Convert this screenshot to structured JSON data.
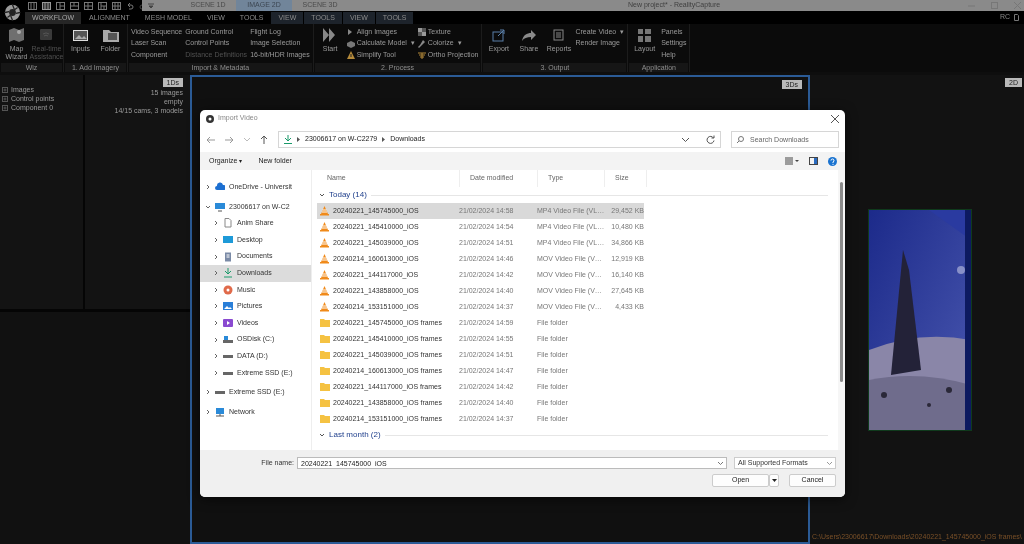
{
  "window": {
    "title": "New project* - RealityCapture",
    "account": "RC"
  },
  "scene_tabs": [
    {
      "label": "SCENE 1D",
      "selected": false
    },
    {
      "label": "IMAGE 2D",
      "selected": true
    },
    {
      "label": "SCENE 3D",
      "selected": false
    }
  ],
  "menu": [
    {
      "label": "WORKFLOW",
      "kind": "main",
      "selected": true
    },
    {
      "label": "ALIGNMENT",
      "kind": "main",
      "selected": false
    },
    {
      "label": "MESH MODEL",
      "kind": "main",
      "selected": false
    },
    {
      "label": "VIEW",
      "kind": "main",
      "selected": false
    },
    {
      "label": "TOOLS",
      "kind": "main",
      "selected": false
    },
    {
      "label": "VIEW",
      "kind": "context",
      "selected": false
    },
    {
      "label": "TOOLS",
      "kind": "context",
      "selected": false
    },
    {
      "label": "VIEW",
      "kind": "context",
      "selected": false
    },
    {
      "label": "TOOLS",
      "kind": "context",
      "selected": false
    }
  ],
  "ribbon": [
    {
      "label": "Wiz",
      "items": [
        {
          "kind": "large",
          "label": "Map Wizard",
          "disabled": false
        },
        {
          "kind": "large",
          "label": "Real-time Assistance",
          "disabled": true
        }
      ]
    },
    {
      "label": "1. Add Imagery",
      "items": [
        {
          "kind": "large",
          "label": "Inputs",
          "disabled": false
        },
        {
          "kind": "large",
          "label": "Folder",
          "disabled": false
        }
      ]
    },
    {
      "label": "Import & Metadata",
      "items": [
        {
          "kind": "list",
          "entries": [
            {
              "label": "Video Sequence",
              "disabled": false
            },
            {
              "label": "Laser Scan",
              "disabled": false
            },
            {
              "label": "Component",
              "disabled": false
            }
          ]
        },
        {
          "kind": "list",
          "entries": [
            {
              "label": "Ground Control",
              "disabled": false
            },
            {
              "label": "Control Points",
              "disabled": false
            },
            {
              "label": "Distance Definitions",
              "disabled": true
            }
          ]
        },
        {
          "kind": "list",
          "entries": [
            {
              "label": "Flight Log",
              "disabled": false
            },
            {
              "label": "Image Selection",
              "disabled": false
            },
            {
              "label": "16-bit/HDR Images",
              "disabled": false
            }
          ]
        }
      ]
    },
    {
      "label": "2. Process",
      "items": [
        {
          "kind": "large",
          "label": "Start",
          "disabled": false
        },
        {
          "kind": "icon-list",
          "entries": [
            {
              "label": "Align Images",
              "disabled": false
            },
            {
              "label": "Calculate Model",
              "caret": "▾",
              "disabled": false
            },
            {
              "label": "Simplify Tool",
              "disabled": false
            }
          ]
        },
        {
          "kind": "icon-list",
          "entries": [
            {
              "label": "Texture",
              "disabled": false
            },
            {
              "label": "Colorize",
              "caret": "▾",
              "disabled": false
            },
            {
              "label": "Ortho Projection",
              "disabled": false
            }
          ]
        }
      ]
    },
    {
      "label": "3. Output",
      "items": [
        {
          "kind": "large",
          "label": "Export",
          "disabled": false
        },
        {
          "kind": "large",
          "label": "Share",
          "disabled": false
        },
        {
          "kind": "large",
          "label": "Reports",
          "disabled": false
        },
        {
          "kind": "list",
          "entries": [
            {
              "label": "Create Video",
              "caret": "▾",
              "disabled": false
            },
            {
              "label": "Render Image",
              "disabled": false
            }
          ]
        }
      ]
    },
    {
      "label": "Application",
      "items": [
        {
          "kind": "large",
          "label": "Layout",
          "disabled": false
        },
        {
          "kind": "list",
          "entries": [
            {
              "label": "Panels",
              "disabled": false
            },
            {
              "label": "Settings",
              "disabled": false
            },
            {
              "label": "Help",
              "disabled": false
            }
          ]
        }
      ]
    }
  ],
  "panels": {
    "tree": [
      {
        "label": "Images",
        "value": "15 images"
      },
      {
        "label": "Control points",
        "value": "empty"
      },
      {
        "label": "Component 0",
        "value": "14/15 cams, 3 models"
      }
    ],
    "badge_1d": "1Ds",
    "badge_3d": "3Ds",
    "badge_2d": "2D",
    "status_path": "C:\\Users\\23006617\\Downloads\\20240221_145745000_iOS frames\\"
  },
  "dialog": {
    "title": "Import Video",
    "address": [
      "23006617 on W-C2279",
      "Downloads"
    ],
    "search": {
      "placeholder": "Search Downloads"
    },
    "commands": [
      {
        "label": "Organize",
        "caret": "▾"
      },
      {
        "label": "New folder"
      }
    ],
    "nav": [
      {
        "label": "OneDrive - Universit",
        "kind": "cloud",
        "expanded": false,
        "selected": false
      },
      {
        "label": "23006617 on W-C2",
        "kind": "pc",
        "expanded": true,
        "selected": false,
        "children": [
          {
            "label": "Anim Share",
            "kind": "share",
            "expanded": false,
            "selected": false
          },
          {
            "label": "Desktop",
            "kind": "desktop",
            "expanded": false,
            "selected": false
          },
          {
            "label": "Documents",
            "kind": "documents",
            "expanded": false,
            "selected": false
          },
          {
            "label": "Downloads",
            "kind": "downloads",
            "expanded": false,
            "selected": true
          },
          {
            "label": "Music",
            "kind": "music",
            "expanded": false,
            "selected": false
          },
          {
            "label": "Pictures",
            "kind": "pictures",
            "expanded": false,
            "selected": false
          },
          {
            "label": "Videos",
            "kind": "videos",
            "expanded": false,
            "selected": false
          },
          {
            "label": "OSDisk (C:)",
            "kind": "system-drive",
            "expanded": false,
            "selected": false
          },
          {
            "label": "DATA (D:)",
            "kind": "drive",
            "expanded": false,
            "selected": false
          },
          {
            "label": "Extreme SSD (E:)",
            "kind": "drive",
            "expanded": false,
            "selected": false
          }
        ]
      },
      {
        "label": "Extreme SSD (E:)",
        "kind": "drive",
        "expanded": false,
        "selected": false
      },
      {
        "label": "Network",
        "kind": "network",
        "expanded": false,
        "selected": false
      }
    ],
    "columns": [
      "Name",
      "Date modified",
      "Type",
      "Size"
    ],
    "groups": [
      {
        "label": "Today (14)",
        "expanded": true,
        "rows": [
          {
            "kind": "video",
            "name": "20240221_145745000_iOS",
            "date": "21/02/2024 14:58",
            "type": "MP4 Video File (VL…",
            "size": "29,452 KB",
            "selected": true
          },
          {
            "kind": "video",
            "name": "20240221_145410000_iOS",
            "date": "21/02/2024 14:54",
            "type": "MP4 Video File (VL…",
            "size": "10,480 KB",
            "selected": false
          },
          {
            "kind": "video",
            "name": "20240221_145039000_iOS",
            "date": "21/02/2024 14:51",
            "type": "MP4 Video File (VL…",
            "size": "34,866 KB",
            "selected": false
          },
          {
            "kind": "video",
            "name": "20240214_160613000_iOS",
            "date": "21/02/2024 14:46",
            "type": "MOV Video File (V…",
            "size": "12,919 KB",
            "selected": false
          },
          {
            "kind": "video",
            "name": "20240221_144117000_iOS",
            "date": "21/02/2024 14:42",
            "type": "MOV Video File (V…",
            "size": "16,140 KB",
            "selected": false
          },
          {
            "kind": "video",
            "name": "20240221_143858000_iOS",
            "date": "21/02/2024 14:40",
            "type": "MOV Video File (V…",
            "size": "27,645 KB",
            "selected": false
          },
          {
            "kind": "video",
            "name": "20240214_153151000_iOS",
            "date": "21/02/2024 14:37",
            "type": "MOV Video File (V…",
            "size": "4,433 KB",
            "selected": false
          },
          {
            "kind": "folder",
            "name": "20240221_145745000_iOS frames",
            "date": "21/02/2024 14:59",
            "type": "File folder",
            "selected": false
          },
          {
            "kind": "folder",
            "name": "20240221_145410000_iOS frames",
            "date": "21/02/2024 14:55",
            "type": "File folder",
            "selected": false
          },
          {
            "kind": "folder",
            "name": "20240221_145039000_iOS frames",
            "date": "21/02/2024 14:51",
            "type": "File folder",
            "selected": false
          },
          {
            "kind": "folder",
            "name": "20240214_160613000_iOS frames",
            "date": "21/02/2024 14:47",
            "type": "File folder",
            "selected": false
          },
          {
            "kind": "folder",
            "name": "20240221_144117000_iOS frames",
            "date": "21/02/2024 14:42",
            "type": "File folder",
            "selected": false
          },
          {
            "kind": "folder",
            "name": "20240221_143858000_iOS frames",
            "date": "21/02/2024 14:40",
            "type": "File folder",
            "selected": false
          },
          {
            "kind": "folder",
            "name": "20240214_153151000_iOS frames",
            "date": "21/02/2024 14:37",
            "type": "File folder",
            "selected": false
          }
        ]
      },
      {
        "label": "Last month (2)",
        "expanded": true
      }
    ],
    "file_name": {
      "label": "File name:",
      "value": "20240221_145745000_iOS"
    },
    "filter": "All Supported Formats",
    "buttons": [
      {
        "label": "Open",
        "kind": "split"
      },
      {
        "label": "Cancel",
        "kind": "plain"
      }
    ]
  }
}
